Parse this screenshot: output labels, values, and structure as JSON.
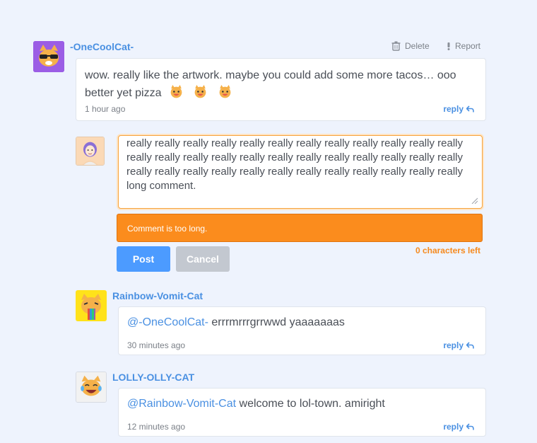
{
  "comments": [
    {
      "username": "-OneCoolCat-",
      "text": "wow. really like the artwork. maybe you could add some more tacos… ooo better yet pizza",
      "emojis": [
        "🐱",
        "🐱",
        "🐱"
      ],
      "time": "1 hour ago",
      "reply_label": "reply",
      "delete_label": "Delete",
      "report_label": "Report"
    },
    {
      "username": "Rainbow-Vomit-Cat",
      "mention": "@-OneCoolCat-",
      "text": " errrmrrrgrrwwd yaaaaaaas",
      "time": "30 minutes ago",
      "reply_label": "reply"
    },
    {
      "username": "LOLLY-OLLY-CAT",
      "mention": "@Rainbow-Vomit-Cat",
      "text": " welcome to lol-town. amiright",
      "time": "12 minutes ago",
      "reply_label": "reply"
    }
  ],
  "composer": {
    "value": "really really really really really really really really really really really really really really really really really really really really really really really really really really really really really really really really really really really really really really really really really really really really really really really really long comment.",
    "error": "Comment is too long.",
    "chars_left": "0 characters left",
    "post_label": "Post",
    "cancel_label": "Cancel"
  },
  "colors": {
    "accent": "#4a90e2",
    "error": "#fb8c1d",
    "background": "#eef3fd"
  }
}
